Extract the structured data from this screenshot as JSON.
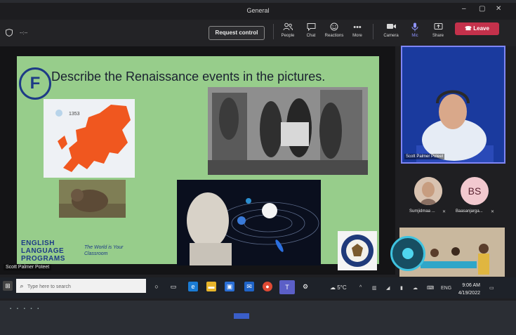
{
  "window": {
    "title": "General",
    "controls": [
      "–",
      "▢",
      "✕"
    ]
  },
  "meeting": {
    "timer": "--:--",
    "request_control": "Request control"
  },
  "toolbar": {
    "people": {
      "label": "People",
      "icon": "people-icon"
    },
    "chat": {
      "label": "Chat",
      "icon": "chat-icon"
    },
    "reactions": {
      "label": "Reactions",
      "icon": "reactions-icon"
    },
    "more": {
      "label": "More",
      "icon": "more-icon"
    },
    "camera": {
      "label": "Camera",
      "icon": "camera-icon"
    },
    "mic": {
      "label": "Mic",
      "icon": "mic-icon"
    },
    "share": {
      "label": "Share",
      "icon": "share-icon"
    },
    "leave": {
      "label": "Leave",
      "color": "#c4314b"
    }
  },
  "slide": {
    "badge": "F",
    "title": "Describe the Renaissance events in the pictures.",
    "map_year": "1353",
    "logo_lines": [
      "ENGLISH",
      "LANGUAGE",
      "PROGRAMS"
    ],
    "tagline": "The World is Your Classroom",
    "accent_color": "#1d3b86",
    "background_color": "#97cd8b"
  },
  "stage": {
    "presenter_caption": "Scott Palmer Poteet"
  },
  "participants": {
    "main": {
      "name": "Scott Palmer Poteet"
    },
    "p1": {
      "name": "Sumjidmaa ..."
    },
    "p2": {
      "name": "Baasanjarga...",
      "initials": "BS"
    }
  },
  "taskbar": {
    "search_placeholder": "Type here to search",
    "weather": "5°C",
    "lang": "ENG",
    "time": "9:06 AM",
    "date": "4/19/2022"
  }
}
